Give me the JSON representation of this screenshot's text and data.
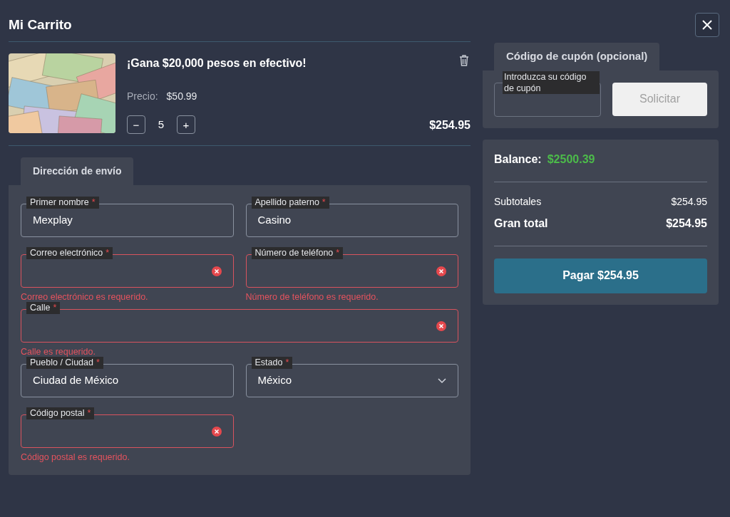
{
  "window": {
    "title": "Mi Carrito"
  },
  "cart_item": {
    "kind": "picture",
    "title": "¡Gana $20,000 pesos en efectivo!",
    "price_label": "Precio:",
    "price": "$50.99",
    "minus": "−",
    "quantity": "5",
    "plus": "+",
    "total": "$254.95"
  },
  "shipping": {
    "tab": "Dirección de envío",
    "fields": [
      {
        "kind": "text",
        "label": "Primer nombre",
        "required_mark": "*",
        "value": "Mexplay",
        "invalid": false,
        "wide": false
      },
      {
        "kind": "text",
        "label": "Apellido paterno",
        "required_mark": "*",
        "value": "Casino",
        "invalid": false,
        "wide": false
      },
      {
        "kind": "text",
        "label": "Correo electrónico",
        "required_mark": "*",
        "invalid": true,
        "error": "Correo electrónico es requerido.",
        "wide": false
      },
      {
        "kind": "text",
        "label": "Número de teléfono",
        "required_mark": "*",
        "invalid": true,
        "error": "Número de teléfono es requerido.",
        "wide": false
      },
      {
        "kind": "text",
        "label": "Calle",
        "required_mark": "*",
        "invalid": true,
        "error": "Calle es requerido.",
        "wide": true
      },
      {
        "kind": "text",
        "label": "Pueblo / Ciudad",
        "required_mark": "*",
        "value": "Ciudad de México",
        "invalid": false,
        "wide": false
      },
      {
        "kind": "select",
        "label": "Estado",
        "required_mark": "*",
        "value": "México",
        "invalid": false,
        "wide": false
      },
      {
        "kind": "text",
        "label": "Código postal",
        "required_mark": "*",
        "invalid": true,
        "error": "Código postal es requerido.",
        "wide": false
      }
    ]
  },
  "coupon": {
    "tab": "Código de cupón (opcional)",
    "placeholder": "Introduzca su código de cupón",
    "button": "Solicitar",
    "button_disabled": true
  },
  "summary": {
    "balance_label": "Balance:",
    "balance": "$2500.39",
    "subtotal_label": "Subtotales",
    "subtotal": "$254.95",
    "total_label": "Gran total",
    "total": "$254.95",
    "pay_button": "Pagar $254.95"
  }
}
